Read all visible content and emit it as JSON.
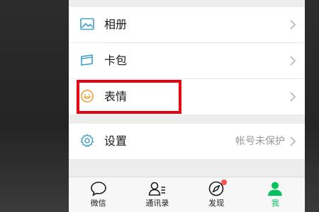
{
  "menu": {
    "items": [
      {
        "label": "相册",
        "icon": "album-icon"
      },
      {
        "label": "卡包",
        "icon": "card-wallet-icon"
      },
      {
        "label": "表情",
        "icon": "sticker-smile-icon",
        "highlighted": true
      },
      {
        "label": "设置",
        "icon": "gear-icon",
        "value": "帐号未保护"
      }
    ]
  },
  "tabbar": {
    "tabs": [
      {
        "label": "微信",
        "icon": "chat-bubble-icon"
      },
      {
        "label": "通讯录",
        "icon": "contacts-icon"
      },
      {
        "label": "发现",
        "icon": "compass-icon",
        "badge": true
      },
      {
        "label": "我",
        "icon": "person-icon",
        "active": true
      }
    ]
  },
  "colors": {
    "accent": "#07c160",
    "highlight_box": "#e60012",
    "badge": "#fa5151",
    "icon_teal": "#3fa0c8",
    "icon_orange": "#f0a040"
  }
}
